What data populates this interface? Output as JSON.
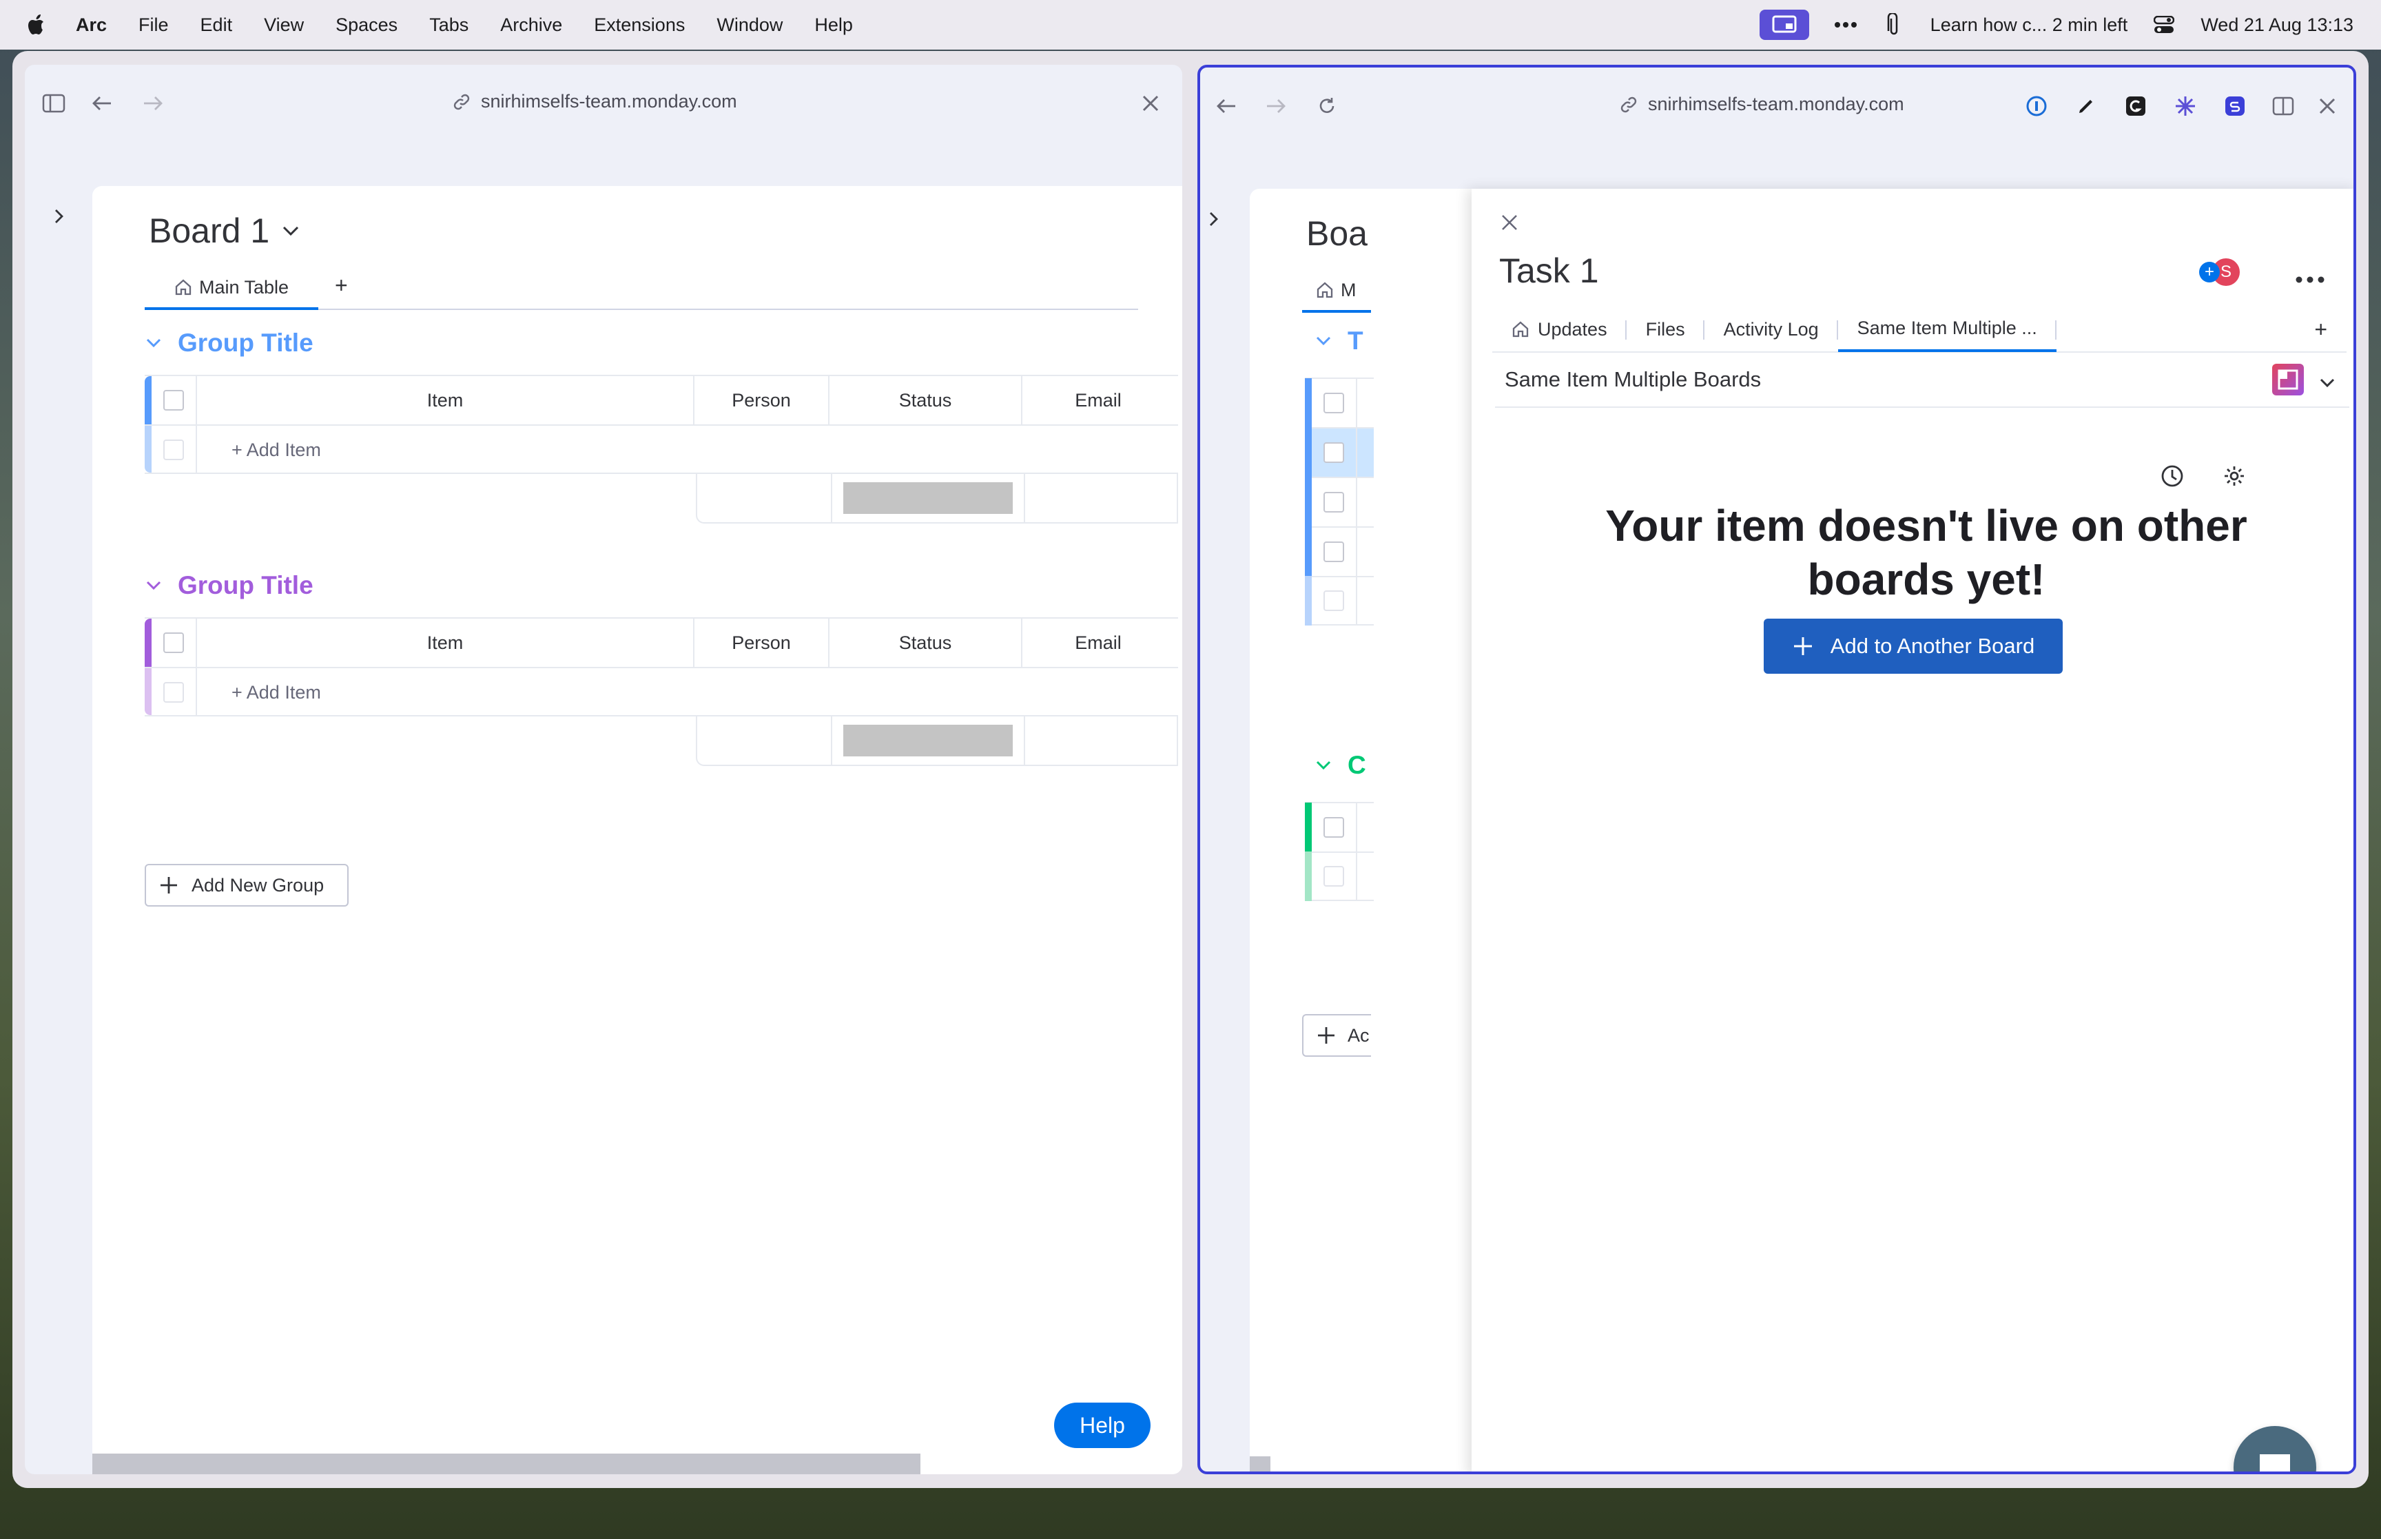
{
  "menubar": {
    "app": "Arc",
    "items": [
      "File",
      "Edit",
      "View",
      "Spaces",
      "Tabs",
      "Archive",
      "Extensions",
      "Window",
      "Help"
    ],
    "now_playing": "Learn how c... 2 min left",
    "clock": "Wed 21 Aug  13:13"
  },
  "left_pane": {
    "url": "snirhimselfs-team.monday.com",
    "board_title": "Board 1",
    "view_tab": "Main Table",
    "view_add": "+",
    "groups": [
      {
        "title": "Group Title",
        "color": "#579bfc",
        "columns": [
          "Item",
          "Person",
          "Status",
          "Email"
        ],
        "add_item": "+ Add Item"
      },
      {
        "title": "Group Title",
        "color": "#a25ddc",
        "columns": [
          "Item",
          "Person",
          "Status",
          "Email"
        ],
        "add_item": "+ Add Item"
      }
    ],
    "add_group": "Add New Group",
    "help": "Help"
  },
  "right_pane": {
    "url": "snirhimselfs-team.monday.com",
    "board_title_partial": "Boa",
    "view_tab_partial": "M",
    "group_partials": [
      "T",
      "C"
    ],
    "add_group_partial": "Ac",
    "task": {
      "title": "Task 1",
      "avatar_initial": "S",
      "tabs": [
        "Updates",
        "Files",
        "Activity Log",
        "Same Item Multiple ..."
      ],
      "tab_add": "+",
      "app_name": "Same Item Multiple Boards",
      "empty_title": "Your item doesn't live on other boards yet!",
      "add_button": "Add to Another Board"
    }
  },
  "colors": {
    "accent": "#0073ea",
    "group_blue": "#579bfc",
    "group_purple": "#a25ddc",
    "group_green": "#00c875",
    "active_pane_border": "#3b3fd8"
  }
}
